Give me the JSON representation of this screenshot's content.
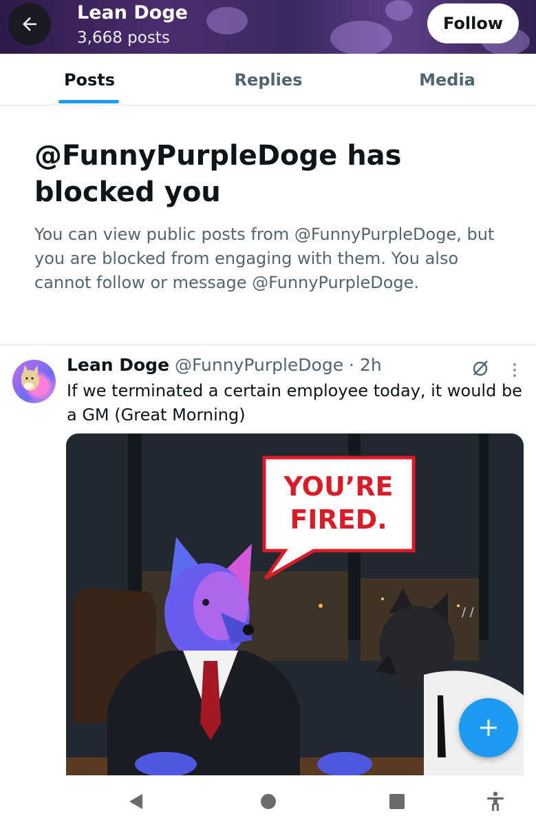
{
  "header": {
    "title": "Lean Doge",
    "post_count": "3,668 posts",
    "follow_label": "Follow",
    "back_icon": "arrow-left-icon"
  },
  "tabs": [
    {
      "label": "Posts",
      "active": true
    },
    {
      "label": "Replies",
      "active": false
    },
    {
      "label": "Media",
      "active": false
    }
  ],
  "blocked": {
    "title": "@FunnyPurpleDoge has blocked you",
    "description": "You can view public posts from @FunnyPurpleDoge, but you are blocked from engaging with them. You also cannot follow or message @FunnyPurpleDoge."
  },
  "post": {
    "author_name": "Lean Doge",
    "handle": "@FunnyPurpleDoge",
    "time": "· 2h",
    "text": "If we terminated a certain employee today, it would be a GM (Great Morning)",
    "image_caption": "YOU’RE FIRED."
  },
  "fab": {
    "icon": "plus-icon"
  },
  "navbar": {
    "icons": [
      "back-triangle-icon",
      "home-circle-icon",
      "recents-square-icon",
      "accessibility-icon"
    ]
  },
  "colors": {
    "accent": "#1d9bf0",
    "text": "#0f1419",
    "secondary": "#536471",
    "speech_text": "#d91c27"
  }
}
